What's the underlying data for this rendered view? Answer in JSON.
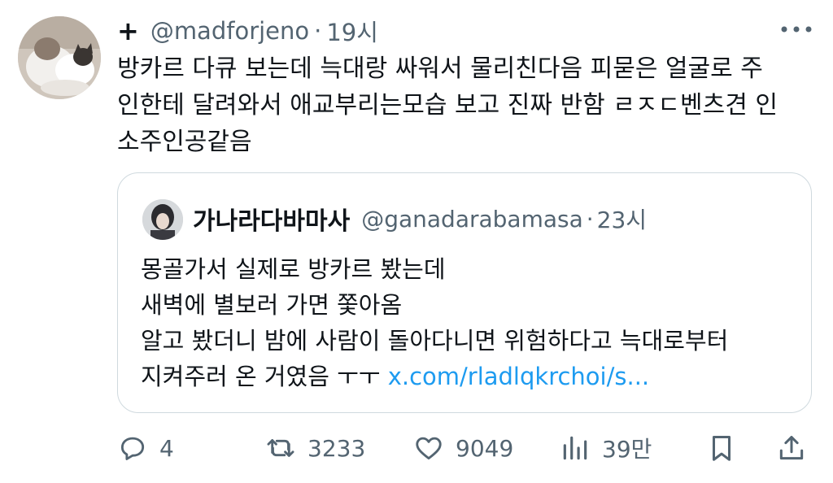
{
  "tweet": {
    "display_name": "+",
    "handle": "@madforjeno",
    "separator": "·",
    "time": "19시",
    "text_lines": [
      "방카르 다큐 보는데 늑대랑 싸워서 물리친다음 피묻은 얼굴로 주",
      "인한테 달려와서 애교부리는모습 보고 진짜 반함 ㄹㅈㄷ벤츠견 인",
      "소주인공같음"
    ]
  },
  "quote": {
    "display_name": "가나라다바마사",
    "handle": "@ganadarabamasa",
    "separator": "·",
    "time": "23시",
    "text_lines": [
      "몽골가서 실제로 방카르 봤는데",
      "새벽에 별보러 가면 쫓아옴",
      "알고 봤더니 밤에 사람이 돌아다니면 위험하다고 늑대로부터"
    ],
    "last_line_text": "지켜주러 온 거였음 ㅜㅜ ",
    "link_text": "x.com/rladlqkrchoi/s..."
  },
  "actions": {
    "reply_count": "4",
    "retweet_count": "3233",
    "like_count": "9049",
    "views_count": "39만"
  },
  "colors": {
    "text": "#0f1419",
    "secondary": "#536471",
    "link": "#1d9bf0",
    "border": "#cfd9de"
  },
  "icons": {
    "more": "more-dots-icon",
    "reply": "reply-bubble-icon",
    "retweet": "retweet-icon",
    "like": "heart-icon",
    "views": "views-bar-chart-icon",
    "bookmark": "bookmark-icon",
    "share": "share-upload-icon"
  }
}
